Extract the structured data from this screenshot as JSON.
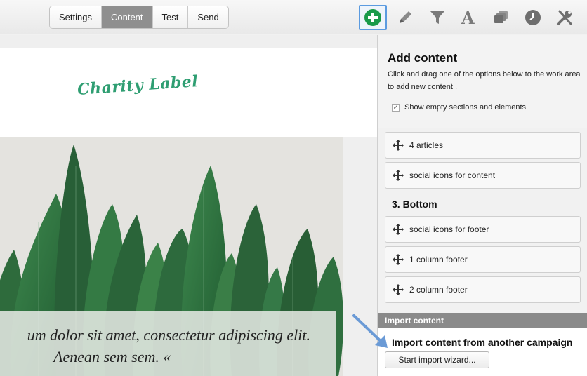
{
  "toolbar": {
    "tabs": [
      {
        "label": "Settings",
        "active": false
      },
      {
        "label": "Content",
        "active": true
      },
      {
        "label": "Test",
        "active": false
      },
      {
        "label": "Send",
        "active": false
      }
    ],
    "tools": [
      "add-content-icon",
      "pencil-icon",
      "filter-icon",
      "font-icon",
      "layers-icon",
      "clock-icon",
      "tools-icon"
    ],
    "accent_color": "#1a9a4a"
  },
  "workarea": {
    "logo_text": "Charity Label",
    "logo_color": "#2f9e72",
    "caption_line1": "um dolor sit amet, consectetur adipiscing elit.",
    "caption_line2": "Aenean sem sem. «"
  },
  "panel": {
    "title": "Add content",
    "description": "Click and drag one of the options below to the work area to add new content .",
    "show_empty_label": "Show empty sections and elements",
    "show_empty_checked": true,
    "items_top": [
      "4 articles",
      "social icons for content"
    ],
    "section_bottom_title": "3. Bottom",
    "items_bottom": [
      "social icons for footer",
      "1 column footer",
      "2 column footer"
    ],
    "import_bar_label": "Import content",
    "import_title": "Import content from another campaign",
    "import_button": "Start import wizard..."
  }
}
